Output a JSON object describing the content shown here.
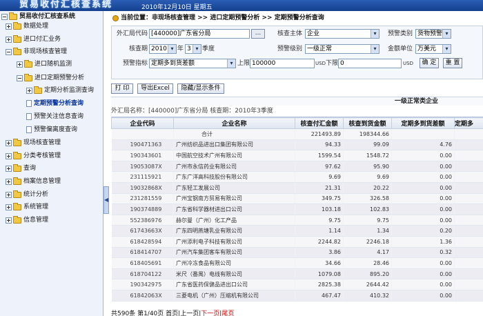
{
  "app": {
    "title": "贸易收付汇核查系统",
    "date": "2010年12月10日 星期五"
  },
  "sidebar": {
    "items": [
      {
        "label": "贸易收付汇核查系统",
        "level": 0
      },
      {
        "label": "数据处理",
        "level": 1
      },
      {
        "label": "进口付汇业务",
        "level": 1
      },
      {
        "label": "非现场核查管理",
        "level": 1
      },
      {
        "label": "进口随机监测",
        "level": 2
      },
      {
        "label": "进口定期预警分析",
        "level": 2
      },
      {
        "label": "定期分析监测查询",
        "level": 3
      },
      {
        "label": "定期预警分析查询",
        "level": 3
      },
      {
        "label": "预警关注信息查询",
        "level": 3
      },
      {
        "label": "预警偏离度查询",
        "level": 3
      },
      {
        "label": "现场核查管理",
        "level": 1
      },
      {
        "label": "分类考核管理",
        "level": 1
      },
      {
        "label": "查询",
        "level": 1
      },
      {
        "label": "档案信息管理",
        "level": 1
      },
      {
        "label": "统计分析",
        "level": 1
      },
      {
        "label": "系统管理",
        "level": 1
      },
      {
        "label": "信息管理",
        "level": 1
      }
    ],
    "collapse_glyph": "◀"
  },
  "breadcrumb": {
    "text": "当前位置：非现场核查管理 >> 进口定期预警分析 >> 定期预警分析查询"
  },
  "filters": {
    "branch_label": "外汇局代码",
    "branch_value": "[440000]广东省分局",
    "branch_btn": "...",
    "subject_label": "核查主体",
    "subject_value": "企业",
    "warn_type_label": "预警类别",
    "warn_type_value": "货物预警",
    "period_label": "核查期",
    "year_value": "2010",
    "year_unit": "年",
    "quarter_value": "3",
    "quarter_unit": "季度",
    "level_label": "预警级别",
    "level_value": "一级正常",
    "unit_label": "金额单位",
    "unit_value": "万美元",
    "indicator_label": "预警指标",
    "indicator_value": "定期多到货差额",
    "upper_label": "上限",
    "upper_value": "100000",
    "upper_unit": "USD",
    "lower_label": "下限",
    "lower_value": "0",
    "lower_unit": "USD",
    "confirm_btn": "确 定",
    "reset_btn": "重 置"
  },
  "toolbar": {
    "print": "打 印",
    "export": "导出Excel",
    "toggle": "隐藏/显示条件"
  },
  "report": {
    "title": "一级正常类企业",
    "meta": "外汇局名称：[440000]广东省分局        核查期：2010年3季度"
  },
  "table": {
    "headers": [
      "企业代码",
      "企业名称",
      "核查付汇金额",
      "核查到货金额",
      "定期多到货差额",
      "定期多"
    ],
    "sum": {
      "label": "合计",
      "paid": "221493.89",
      "received": "198344.66"
    },
    "rows": [
      [
        "190471363",
        "广州纺织品进出口集团有限公司",
        "94.33",
        "99.09",
        "4.76"
      ],
      [
        "190343601",
        "中国航空技术广州有限公司",
        "1599.54",
        "1548.72",
        "0.00"
      ],
      [
        "19053087X",
        "广州市永信药业有限公司",
        "97.62",
        "95.90",
        "0.00"
      ],
      [
        "231115921",
        "广东广洋高科技股份有限公司",
        "9.69",
        "9.69",
        "0.00"
      ],
      [
        "19032868X",
        "广东轻工发展公司",
        "21.31",
        "20.22",
        "0.00"
      ],
      [
        "231281559",
        "广州宝钢南方贸易有限公司",
        "349.75",
        "326.58",
        "0.00"
      ],
      [
        "190374889",
        "广东省科学器材进出口公司",
        "103.18",
        "102.83",
        "0.00"
      ],
      [
        "552386976",
        "赫尔曼（广州）化工产品",
        "9.75",
        "9.75",
        "0.00"
      ],
      [
        "61743663X",
        "广东四明燕塘乳业有限公司",
        "1.14",
        "1.34",
        "0.20"
      ],
      [
        "618428594",
        "广州添利电子科技有限公司",
        "2244.82",
        "2246.18",
        "1.36"
      ],
      [
        "618414707",
        "广州汽车集团客车有限公司",
        "3.86",
        "4.17",
        "0.32"
      ],
      [
        "618405691",
        "广州冷冻食品有限公司",
        "34.66",
        "28.46",
        "0.00"
      ],
      [
        "618704122",
        "米尺（番禺）电线有限公司",
        "1079.08",
        "895.20",
        "0.00"
      ],
      [
        "190342975",
        "广东省医药保健品进出口公司",
        "2825.38",
        "2644.42",
        "0.00"
      ],
      [
        "61842063X",
        "三菱电机（广州）压缩机有限公司",
        "467.47",
        "410.32",
        "0.00"
      ]
    ]
  },
  "pager": {
    "total": "共590条",
    "page": "第1/40页",
    "first": "首页",
    "prev": "上一页",
    "next": "下一页",
    "last": "尾页"
  }
}
